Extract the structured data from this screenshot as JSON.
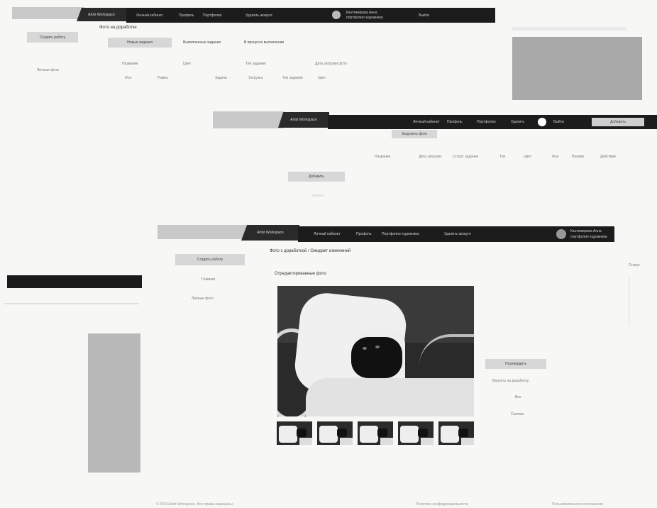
{
  "shot_a": {
    "tab_active": "Artist Workspace",
    "nav_items": [
      "Личный кабинет",
      "Профиль",
      "Портфолио",
      "Удалить аккаунт"
    ],
    "user_name": "Кантемирова Анна",
    "user_sub": "портфолио художника",
    "logout": "Выйти",
    "left_button": "Создать работу",
    "left_link": "Личные фото",
    "heading": "Фото на доработке",
    "tabs": [
      "Новые задания",
      "Выполненные задания",
      "В процессе выполнения"
    ],
    "row1": [
      "Название",
      "Цвет",
      "Тип задания",
      "Дата загрузки фото"
    ],
    "row2": [
      "Фон",
      "Рамка",
      "Задача",
      "Загрузка",
      "Тип задания",
      "Цвет"
    ]
  },
  "shot_b": {
    "tab_active": "Artist Workspace",
    "nav_items": [
      "Личный кабинет",
      "Профиль",
      "Портфолио",
      "Удалить",
      "Выйти"
    ],
    "action_button": "Добавить",
    "top_button": "Загрузить фото",
    "columns": [
      "Название",
      "Дата загрузки",
      "Статус задания",
      "Тип",
      "Цвет",
      "Фон",
      "Размер",
      "Действие"
    ],
    "left_button": "Добавить"
  },
  "shot_c": {
    "tab_active": "Artist Workspace",
    "nav_items": [
      "Личный кабинет",
      "Профиль",
      "Портфолио художника",
      "Удалить аккаунт"
    ],
    "user_name": "Кантемирова Анна",
    "user_sub": "портфолио художника",
    "left_button": "Создать работу",
    "left_links": [
      "Главная",
      "Личные фото"
    ],
    "breadcrumb": "Фото с доработкой / Ожидает изменений",
    "section_title": "Отредактированные фото",
    "right_button": "Подтвердить",
    "right_link": "Вернуть на доработку",
    "right_small": [
      "Все",
      "Скачать"
    ],
    "right_edge": "Статус",
    "footer_left": "© 2024 Artist Workspace. Все права защищены",
    "footer_mid": "Политика конфиденциальности",
    "footer_right": "Пользовательское соглашение"
  },
  "thumb_count": 5
}
